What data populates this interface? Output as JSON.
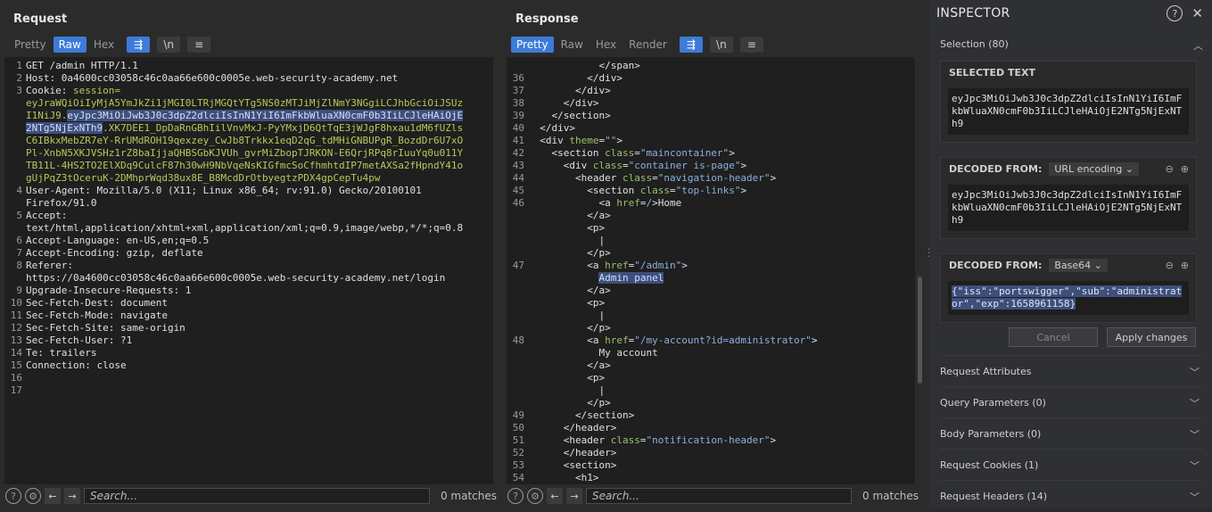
{
  "view_buttons": [
    "split-horizontal",
    "split-vertical",
    "single"
  ],
  "request": {
    "title": "Request",
    "tabs": [
      "Pretty",
      "Raw",
      "Hex"
    ],
    "active_tab": "Raw",
    "line_numbers": [
      "1",
      "2",
      "3",
      "",
      "",
      "",
      "",
      "",
      "",
      "",
      "4",
      "",
      "5",
      "",
      "6",
      "7",
      "8",
      "",
      "9",
      "10",
      "11",
      "12",
      "13",
      "14",
      "15",
      "16",
      "17"
    ],
    "lines": [
      "GET /admin HTTP/1.1",
      "Host: 0a4600cc03058c46c0aa66e600c0005e.web-security-academy.net",
      "Cookie: session=",
      "eyJraWQiOiIyMjA5YmJkZi1jMGI0LTRjMGQtYTg5NS0zMTJiMjZlNmY3NGgiLCJhbGciOiJSUz",
      "I1NiJ9.eyJpc3MiOiJwb3J0c3dpZ2dlciIsInN1YiI6ImFkbWluaXN0cmF0b3IiLCJleHAiOjE",
      "2NTg5NjExNTh9.XK7DEE1_DpDaRnGBhIilVnvMxJ-PyYMxjD6QtTqE3jWJgF8hxau1dM6fUZls",
      "C6IBkxMebZR7eY-RrUMdROH19qexzey_CwJb8Trkkx1eqD2qG_tdMHiGNBUPgR_BozdDr6U7xO",
      "Pl-XnbN5XKJVSHz1rZ8baIjjaQHBSGbKJVUh_gvrMiZbopTJRKON-E6QrjRPq8rIuuYq0u011Y",
      "TB11L-4HS2TO2ElXDq9CulcF87h30wH9NbVqeNsKIGfmcSoCfhmhtdIP7metAXSa2fHpndY41o",
      "gUjPqZ3tOceruK-2DMhprWqd38ux8E_B8McdDrOtbyegtzPDX4gpCepTu4pw",
      "User-Agent: Mozilla/5.0 (X11; Linux x86_64; rv:91.0) Gecko/20100101",
      "Firefox/91.0",
      "Accept:",
      "text/html,application/xhtml+xml,application/xml;q=0.9,image/webp,*/*;q=0.8",
      "Accept-Language: en-US,en;q=0.5",
      "Accept-Encoding: gzip, deflate",
      "Referer:",
      "https://0a4600cc03058c46c0aa66e600c0005e.web-security-academy.net/login",
      "Upgrade-Insecure-Requests: 1",
      "Sec-Fetch-Dest: document",
      "Sec-Fetch-Mode: navigate",
      "Sec-Fetch-Site: same-origin",
      "Sec-Fetch-User: ?1",
      "Te: trailers",
      "Connection: close",
      "",
      ""
    ],
    "search_placeholder": "Search...",
    "matches": "0 matches"
  },
  "response": {
    "title": "Response",
    "tabs": [
      "Pretty",
      "Raw",
      "Hex",
      "Render"
    ],
    "active_tab": "Pretty",
    "line_numbers": [
      "",
      "36",
      "37",
      "38",
      "39",
      "40",
      "41",
      "42",
      "43",
      "44",
      "45",
      "46",
      "",
      "",
      "",
      "",
      "47",
      "",
      "",
      "",
      "",
      "",
      "48",
      "",
      "",
      "",
      "",
      "",
      "49",
      "50",
      "51",
      "52",
      "53",
      "54"
    ],
    "lines": [
      "            </span>",
      "          </div>",
      "        </div>",
      "      </div>",
      "    </section>",
      "  </div>",
      "  <div theme=\"\">",
      "    <section class=\"maincontainer\">",
      "      <div class=\"container is-page\">",
      "        <header class=\"navigation-header\">",
      "          <section class=\"top-links\">",
      "            <a href=/>Home",
      "          </a>",
      "          <p>",
      "            |",
      "          </p>",
      "          <a href=\"/admin\">",
      "            Admin panel",
      "          </a>",
      "          <p>",
      "            |",
      "          </p>",
      "          <a href=\"/my-account?id=administrator\">",
      "            My account",
      "          </a>",
      "          <p>",
      "            |",
      "          </p>",
      "        </section>",
      "      </header>",
      "      <header class=\"notification-header\">",
      "      </header>",
      "      <section>",
      "        <h1>"
    ],
    "search_placeholder": "Search...",
    "matches": "0 matches"
  },
  "inspector": {
    "title": "INSPECTOR",
    "selection_label": "Selection (80)",
    "selected_text_label": "SELECTED TEXT",
    "selected_text": "eyJpc3MiOiJwb3J0c3dpZ2dlciIsInN1YiI6ImFkbWluaXN0cmF0b3IiLCJleHAiOjE2NTg5NjExNTh9",
    "decoded1_label": "DECODED FROM:",
    "decoded1_type": "URL encoding",
    "decoded1_text": "eyJpc3MiOiJwb3J0c3dpZ2dlciIsInN1YiI6ImFkbWluaXN0cmF0b3IiLCJleHAiOjE2NTg5NjExNTh9",
    "decoded2_label": "DECODED FROM:",
    "decoded2_type": "Base64",
    "decoded2_text": "{\"iss\":\"portswigger\",\"sub\":\"administrator\",\"exp\":1658961158}",
    "cancel_label": "Cancel",
    "apply_label": "Apply changes",
    "sections": [
      "Request Attributes",
      "Query Parameters (0)",
      "Body Parameters (0)",
      "Request Cookies (1)",
      "Request Headers (14)"
    ]
  }
}
